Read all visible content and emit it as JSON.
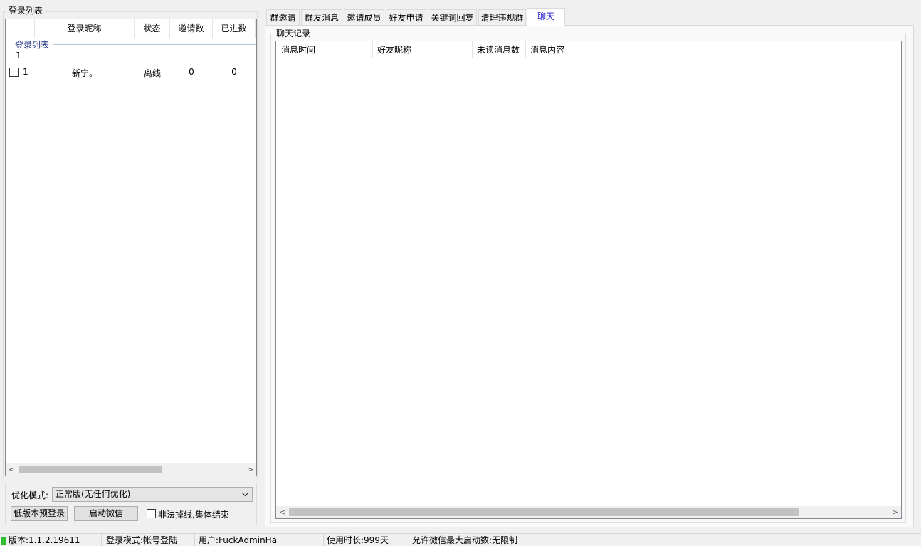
{
  "left_panel": {
    "group_title": "登录列表",
    "columns": [
      "登录昵称",
      "状态",
      "邀请数",
      "已进数"
    ],
    "group": {
      "label": "登录列表",
      "count": "1"
    },
    "rows": [
      {
        "id": "1",
        "nickname": "新宁。",
        "status": "离线",
        "invites": "0",
        "joined": "0",
        "checked": false
      }
    ],
    "scroll_left": "<",
    "scroll_right": ">"
  },
  "controls": {
    "mode_label": "优化模式:",
    "mode_value": "正常版(无任何优化)",
    "low_version_button": "低版本预登录",
    "start_wechat_button": "启动微信",
    "checkbox_label": "非法掉线,集体结束",
    "checkbox_checked": false
  },
  "tabs": [
    {
      "label": "群邀请",
      "active": false
    },
    {
      "label": "群发消息",
      "active": false
    },
    {
      "label": "邀请成员",
      "active": false
    },
    {
      "label": "好友申请",
      "active": false
    },
    {
      "label": "关键词回复",
      "active": false
    },
    {
      "label": "清理违规群",
      "active": false
    },
    {
      "label": "聊天",
      "active": true
    }
  ],
  "chat": {
    "group_title": "聊天记录",
    "columns": [
      "消息时间",
      "好友昵称",
      "未读消息数",
      "消息内容"
    ],
    "rows": []
  },
  "status_bar": {
    "version": "版本:1.1.2.19611",
    "login_mode": "登录模式:帐号登陆",
    "user": "用户:FuckAdminHa",
    "usage": "使用时长:999天",
    "max_start": "允许微信最大启动数:无限制"
  },
  "colors": {
    "active_tab_text": "#1a1acd",
    "group_label": "#1e3287",
    "status_indicator": "#2fbf2f"
  }
}
